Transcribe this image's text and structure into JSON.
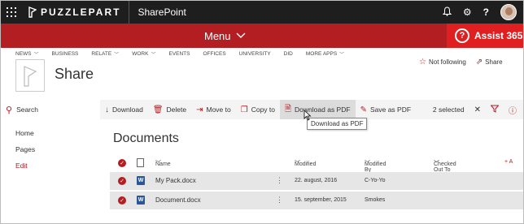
{
  "topbar": {
    "brand": "PUZZLEPART",
    "app": "SharePoint",
    "icons": [
      "waffle-icon",
      "bell-icon",
      "gear-icon",
      "help-icon",
      "avatar"
    ]
  },
  "redbar": {
    "menu_label": "Menu",
    "assist_label": "Assist 365",
    "assist_icon": "?"
  },
  "nav": {
    "items": [
      {
        "label": "NEWS",
        "dropdown": true
      },
      {
        "label": "BUSINESS",
        "dropdown": false
      },
      {
        "label": "RELATE",
        "dropdown": true
      },
      {
        "label": "WORK",
        "dropdown": true
      },
      {
        "label": "EVENTS",
        "dropdown": false
      },
      {
        "label": "OFFICES",
        "dropdown": false
      },
      {
        "label": "UNIVERSITY",
        "dropdown": false
      },
      {
        "label": "DID",
        "dropdown": false
      },
      {
        "label": "MORE APPS",
        "dropdown": true
      }
    ]
  },
  "site": {
    "title": "Share",
    "not_following": "Not following",
    "share": "Share"
  },
  "search": {
    "label": "Search"
  },
  "commands": {
    "download": "Download",
    "delete": "Delete",
    "move_to": "Move to",
    "copy_to": "Copy to",
    "download_pdf": "Download as PDF",
    "save_pdf": "Save as PDF",
    "selected": "2 selected"
  },
  "tooltip": "Download as PDF",
  "leftnav": {
    "home": "Home",
    "pages": "Pages",
    "edit": "Edit"
  },
  "documents": {
    "title": "Documents",
    "columns": {
      "name": "Name",
      "modified": "Modified",
      "modified_by": "Modified By",
      "checked_out": "Checked Out To",
      "add": "+ A"
    },
    "rows": [
      {
        "name": "My Pack.docx",
        "modified": "22. august, 2016",
        "modified_by": "C-Yo-Yo"
      },
      {
        "name": "Document.docx",
        "modified": "15. september, 2015",
        "modified_by": "Smokes"
      }
    ]
  },
  "colors": {
    "accent": "#b31e23",
    "topbar": "#1e1e1e",
    "assist": "#e02020"
  }
}
